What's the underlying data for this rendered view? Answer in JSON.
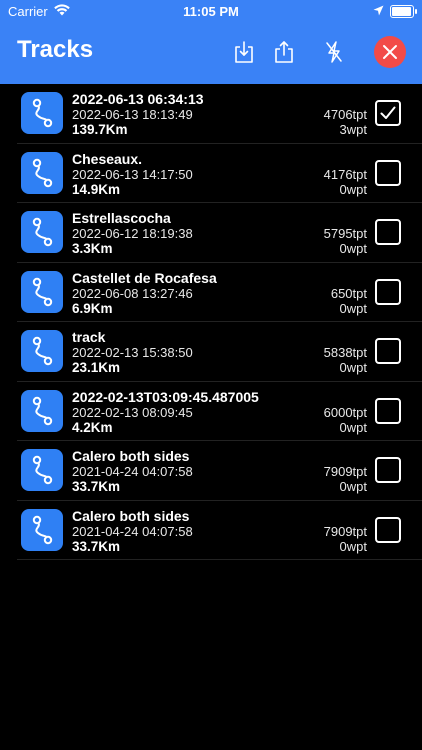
{
  "status_bar": {
    "carrier": "Carrier",
    "time": "11:05 PM"
  },
  "nav": {
    "title": "Tracks",
    "icons": [
      "download-icon",
      "share-icon",
      "flash-off-icon",
      "close-icon"
    ]
  },
  "colors": {
    "accent": "#3a82f6",
    "close": "#f24b48",
    "tile": "#2f80f4"
  },
  "tracks": [
    {
      "title": "2022-06-13 06:34:13",
      "date": "2022-06-13 18:13:49",
      "distance": "139.7Km",
      "points": "4706tpt",
      "waypoints": "3wpt",
      "checked": true
    },
    {
      "title": "Cheseaux.",
      "date": "2022-06-13 14:17:50",
      "distance": "14.9Km",
      "points": "4176tpt",
      "waypoints": "0wpt",
      "checked": false
    },
    {
      "title": "Estrellascocha",
      "date": "2022-06-12 18:19:38",
      "distance": "3.3Km",
      "points": "5795tpt",
      "waypoints": "0wpt",
      "checked": false
    },
    {
      "title": "Castellet de Rocafesa",
      "date": "2022-06-08 13:27:46",
      "distance": "6.9Km",
      "points": "650tpt",
      "waypoints": "0wpt",
      "checked": false
    },
    {
      "title": "track",
      "date": "2022-02-13 15:38:50",
      "distance": "23.1Km",
      "points": "5838tpt",
      "waypoints": "0wpt",
      "checked": false
    },
    {
      "title": "2022-02-13T03:09:45.487005",
      "date": "2022-02-13 08:09:45",
      "distance": "4.2Km",
      "points": "6000tpt",
      "waypoints": "0wpt",
      "checked": false
    },
    {
      "title": "Calero both sides",
      "date": "2021-04-24 04:07:58",
      "distance": "33.7Km",
      "points": "7909tpt",
      "waypoints": "0wpt",
      "checked": false
    },
    {
      "title": "Calero both sides",
      "date": "2021-04-24 04:07:58",
      "distance": "33.7Km",
      "points": "7909tpt",
      "waypoints": "0wpt",
      "checked": false
    }
  ]
}
